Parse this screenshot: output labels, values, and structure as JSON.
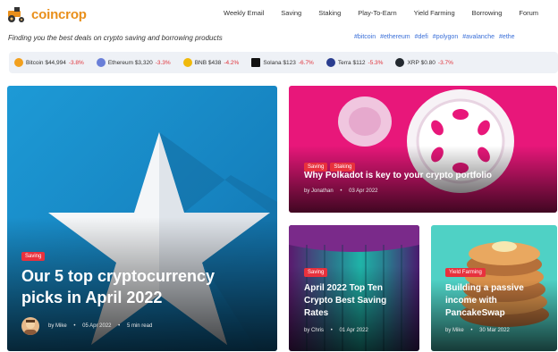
{
  "brand": {
    "name": "coincrop"
  },
  "nav": [
    "Weekly Email",
    "Saving",
    "Staking",
    "Play-To-Earn",
    "Yield Farming",
    "Borrowing",
    "Forum"
  ],
  "tagline": "Finding you the best deals on crypto saving and borrowing products",
  "tags": [
    "#bitcoin",
    "#ethereum",
    "#defi",
    "#polygon",
    "#avalanche",
    "#ethe"
  ],
  "ticker": [
    {
      "name": "Bitcoin",
      "price": "$44,994",
      "change": "-3.8%",
      "color": "#f2a01e",
      "icon": "bitcoin-icon"
    },
    {
      "name": "Ethereum",
      "price": "$3,320",
      "change": "-3.3%",
      "color": "#6a7fd8",
      "icon": "ethereum-icon"
    },
    {
      "name": "BNB",
      "price": "$438",
      "change": "-4.2%",
      "color": "#f0b90b",
      "icon": "bnb-icon"
    },
    {
      "name": "Solana",
      "price": "$123",
      "change": "-6.7%",
      "color": "#111111",
      "icon": "solana-icon"
    },
    {
      "name": "Terra",
      "price": "$112",
      "change": "-5.3%",
      "color": "#2a3d8f",
      "icon": "terra-icon"
    },
    {
      "name": "XRP",
      "price": "$0.80",
      "change": "-3.7%",
      "color": "#23292f",
      "icon": "xrp-icon"
    }
  ],
  "cards": {
    "main": {
      "category": "Saving",
      "title_line1": "Our 5 top cryptocurrency",
      "title_line2": "picks in April 2022",
      "author": "by Mike",
      "date": "05 Apr 2022",
      "read": "5 min read"
    },
    "polkadot": {
      "categories": [
        "Saving",
        "Staking"
      ],
      "title": "Why Polkadot is key to your crypto portfolio",
      "author": "by Jonathan",
      "date": "03 Apr 2022"
    },
    "april": {
      "category": "Saving",
      "title_line1": "April 2022 Top Ten",
      "title_line2": "Crypto Best Saving",
      "title_line3": "Rates",
      "author": "by Chris",
      "date": "01 Apr 2022"
    },
    "pancake": {
      "category": "Yield Farming",
      "title_line1": "Building a passive",
      "title_line2": "income with",
      "title_line3": "PancakeSwap",
      "author": "by Mike",
      "date": "30 Mar 2022"
    }
  },
  "colors": {
    "brand": "#e98f1a",
    "category": "#e8313d",
    "tag": "#3a6fd8",
    "negative": "#e0323a"
  }
}
